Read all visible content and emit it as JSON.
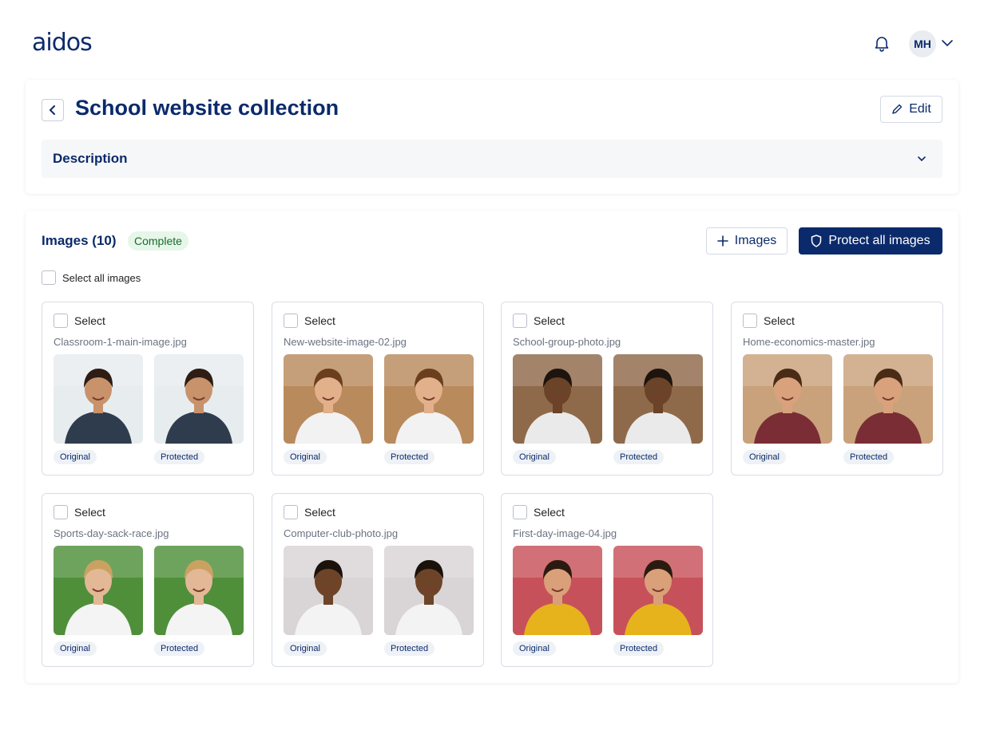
{
  "app": {
    "logo": "aidos",
    "user_initials": "MH"
  },
  "header": {
    "title": "School website collection",
    "edit_label": "Edit",
    "description_label": "Description"
  },
  "images_section": {
    "title": "Images (10)",
    "status": "Complete",
    "add_label": "Images",
    "protect_label": "Protect all images",
    "select_all_label": "Select all images"
  },
  "tiles": [
    {
      "select_label": "Select",
      "filename": "Classroom-1-main-image.jpg",
      "original_label": "Original",
      "protected_label": "Protected",
      "palette": {
        "bg": "#e7ecef",
        "skin": "#c8926b",
        "clothes": "#2f3c4d",
        "hair": "#2d1d14"
      }
    },
    {
      "select_label": "Select",
      "filename": "New-website-image-02.jpg",
      "original_label": "Original",
      "protected_label": "Protected",
      "palette": {
        "bg": "#b98a5c",
        "skin": "#e2b08a",
        "clothes": "#f2f2f2",
        "hair": "#6b3f1e"
      }
    },
    {
      "select_label": "Select",
      "filename": "School-group-photo.jpg",
      "original_label": "Original",
      "protected_label": "Protected",
      "palette": {
        "bg": "#8f6a4a",
        "skin": "#6b4328",
        "clothes": "#eaeaea",
        "hair": "#1e140e"
      }
    },
    {
      "select_label": "Select",
      "filename": "Home-economics-master.jpg",
      "original_label": "Original",
      "protected_label": "Protected",
      "palette": {
        "bg": "#c9a27c",
        "skin": "#d9a27c",
        "clothes": "#7a2d35",
        "hair": "#4a2b16"
      }
    },
    {
      "select_label": "Select",
      "filename": "Sports-day-sack-race.jpg",
      "original_label": "Original",
      "protected_label": "Protected",
      "palette": {
        "bg": "#4f8f3a",
        "skin": "#e3b896",
        "clothes": "#f4f4f4",
        "hair": "#c9a261"
      }
    },
    {
      "select_label": "Select",
      "filename": "Computer-club-photo.jpg",
      "original_label": "Original",
      "protected_label": "Protected",
      "palette": {
        "bg": "#d9d4d6",
        "skin": "#6e4428",
        "clothes": "#f3f3f3",
        "hair": "#1b120c"
      }
    },
    {
      "select_label": "Select",
      "filename": "First-day-image-04.jpg",
      "original_label": "Original",
      "protected_label": "Protected",
      "palette": {
        "bg": "#c7515a",
        "skin": "#d9a07a",
        "clothes": "#e6b31c",
        "hair": "#2b1a10"
      }
    }
  ],
  "colors": {
    "brand": "#0b2a6b",
    "status_bg": "#e6f6e9",
    "status_text": "#1b6b2e"
  },
  "icons": [
    "bell-icon",
    "chevron-down-icon",
    "back-arrow-icon",
    "pencil-icon",
    "plus-icon",
    "shield-icon"
  ]
}
